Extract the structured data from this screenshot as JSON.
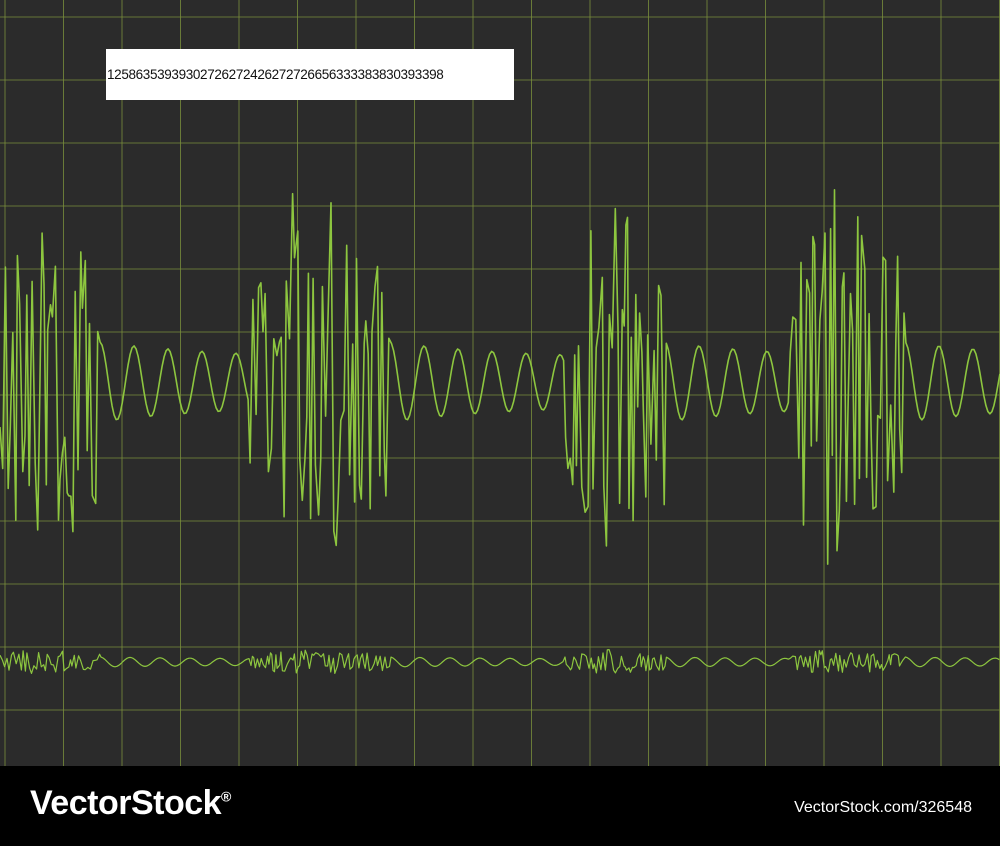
{
  "screen": {
    "readout": "12586353939302726272426272726656333383830393398",
    "trace_color": "#8dc63f",
    "grid_color": "#7a8f3c",
    "background_color": "#2b2b2b"
  },
  "footer": {
    "brand": "VectorStock",
    "brand_mark": "®",
    "image_id": "VectorStock.com/326548"
  }
}
